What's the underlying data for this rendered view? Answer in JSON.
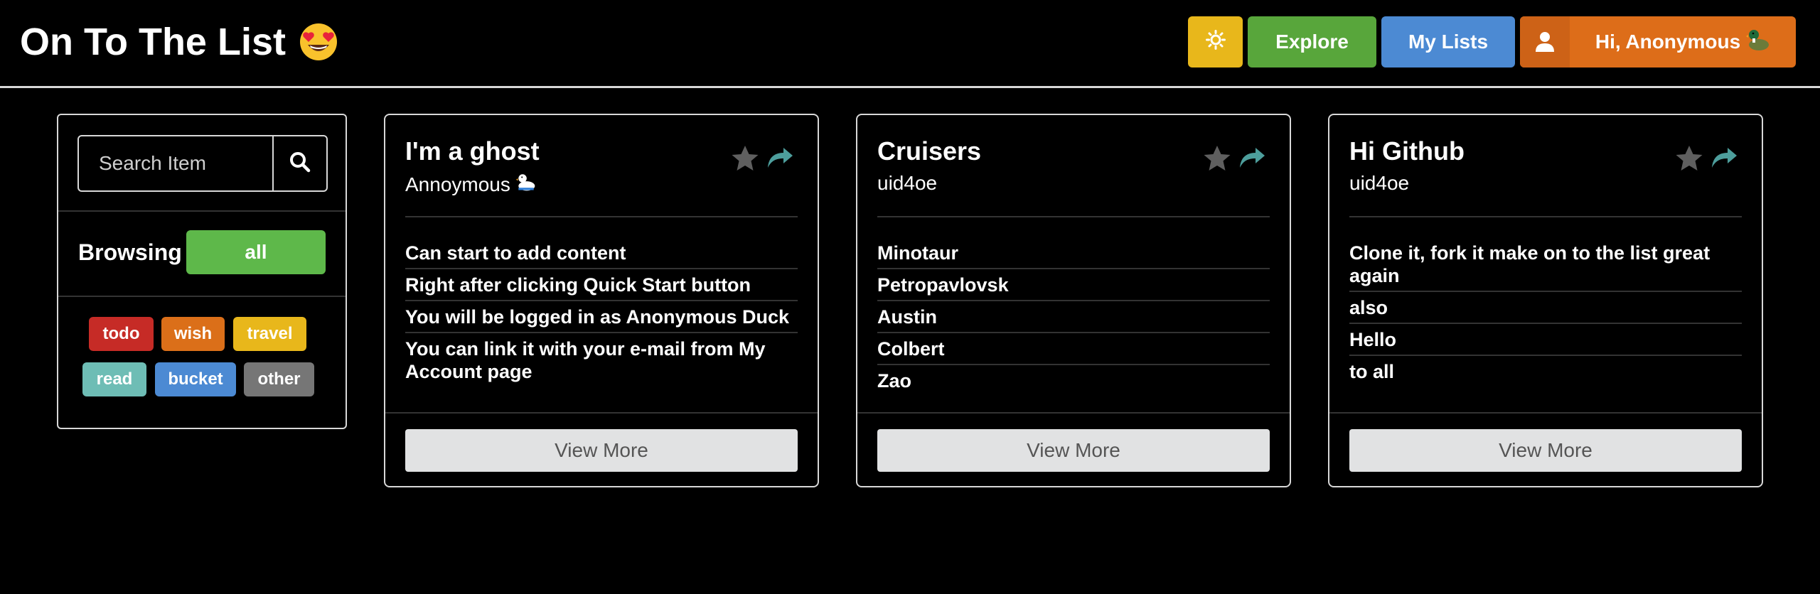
{
  "header": {
    "brand": "On To The List",
    "brand_emoji": "heart-eyes-emoji",
    "theme_icon": "sun-icon",
    "explore_label": "Explore",
    "my_lists_label": "My Lists",
    "user_greeting": "Hi, Anonymous",
    "user_emoji": "duck-emoji",
    "colors": {
      "theme": "#e8b71b",
      "explore": "#58a63b",
      "my_lists": "#4c8ad3",
      "user": "#dd6d19"
    }
  },
  "sidebar": {
    "search_placeholder": "Search Item",
    "search_icon": "search-icon",
    "browsing_label": "Browsing",
    "selected_filter": "all",
    "tags": [
      {
        "label": "todo",
        "color": "#c62b26"
      },
      {
        "label": "wish",
        "color": "#db6f19"
      },
      {
        "label": "travel",
        "color": "#e8b71b"
      },
      {
        "label": "read",
        "color": "#6ebdb5"
      },
      {
        "label": "bucket",
        "color": "#4c8ad3"
      },
      {
        "label": "other",
        "color": "#767676"
      }
    ]
  },
  "cards": [
    {
      "title": "I'm a ghost",
      "author": "Annoymous",
      "author_emoji": "duck-emoji",
      "items": [
        "Can start to add content",
        "Right after clicking Quick Start button",
        "You will be logged in as Anonymous Duck",
        "You can link it with your e-mail from My Account page"
      ],
      "view_more": "View More"
    },
    {
      "title": "Cruisers",
      "author": "uid4oe",
      "items": [
        "Minotaur",
        "Petropavlovsk",
        "Austin",
        "Colbert",
        "Zao"
      ],
      "view_more": "View More"
    },
    {
      "title": "Hi Github",
      "author": "uid4oe",
      "items": [
        "Clone it, fork it make on to the list great again",
        "also",
        "Hello",
        "to all"
      ],
      "view_more": "View More"
    }
  ],
  "card_icons": {
    "star": "star-icon",
    "share": "share-icon",
    "star_color": "#5f5f5f",
    "share_color": "#4d9e9c"
  }
}
